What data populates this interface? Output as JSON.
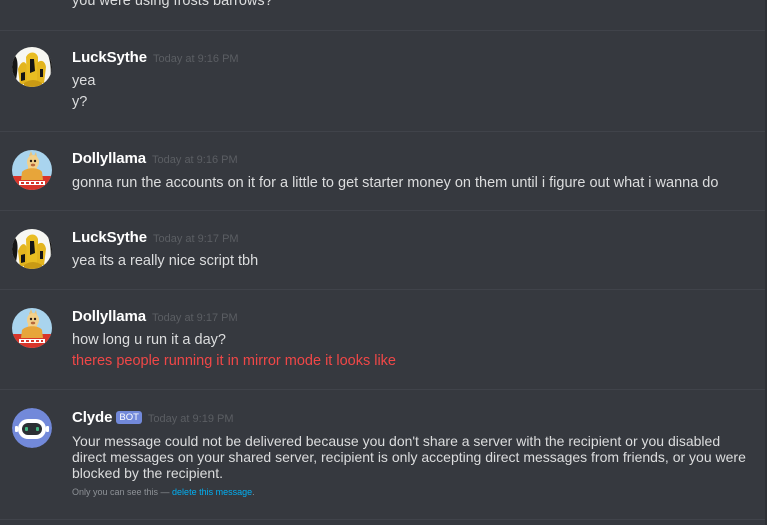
{
  "previous_message": {
    "text": "you were using frosts barrows?"
  },
  "messages": [
    {
      "author": "LuckSythe",
      "timestamp": "Today at 9:16 PM",
      "lines": [
        "yea",
        "y?"
      ]
    },
    {
      "author": "Dollyllama",
      "timestamp": "Today at 9:16 PM",
      "lines": [
        "gonna run the accounts on it for a little to get starter money on them until i figure out what i wanna do"
      ]
    },
    {
      "author": "LuckSythe",
      "timestamp": "Today at 9:17 PM",
      "lines": [
        "yea its a really nice script tbh"
      ]
    },
    {
      "author": "Dollyllama",
      "timestamp": "Today at 9:17 PM",
      "lines": [
        "how long u run it a day?",
        "theres people running it in mirror mode it looks like"
      ]
    },
    {
      "author": "Clyde",
      "bot_tag": "BOT",
      "timestamp": "Today at 9:19 PM",
      "lines": [
        "Your message could not be delivered because you don't share a server with the recipient or you disabled direct messages on your shared server, recipient is only accepting direct messages from friends, or you were blocked by the recipient."
      ],
      "ephemeral_prefix": "Only you can see this — ",
      "ephemeral_link": "delete this message",
      "ephemeral_suffix": "."
    }
  ],
  "colors": {
    "background": "#36393f",
    "username": "#ffffff",
    "message_text": "#dcddde",
    "timestamp": "#5b5e63",
    "error_text": "#f04747",
    "bot_tag": "#7289da",
    "link": "#00b0f4"
  },
  "icons": {
    "lucksythe_avatar": "yellow-black-pattern-avatar-icon",
    "dollyllama_avatar": "llama-avatar-icon",
    "clyde_avatar": "clyde-bot-avatar-icon"
  }
}
